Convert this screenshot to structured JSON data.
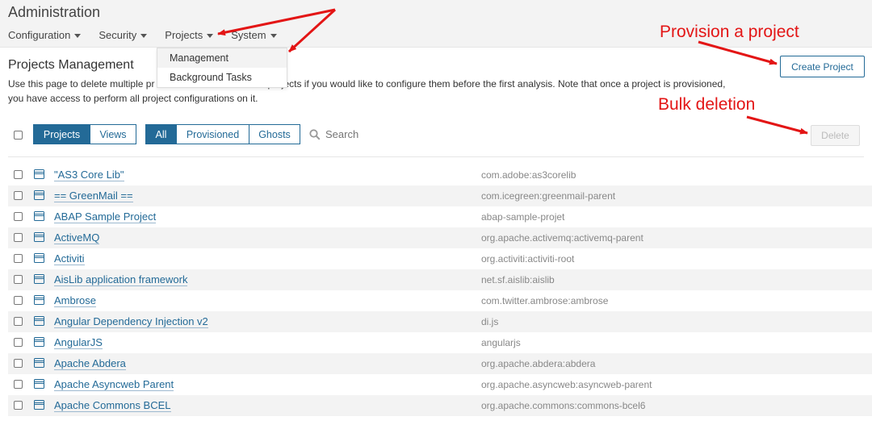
{
  "header": {
    "title": "Administration",
    "nav": [
      {
        "label": "Configuration"
      },
      {
        "label": "Security"
      },
      {
        "label": "Projects"
      },
      {
        "label": "System"
      }
    ],
    "dropdown": [
      {
        "label": "Management"
      },
      {
        "label": "Background Tasks"
      }
    ]
  },
  "page": {
    "title": "Projects Management",
    "desc_line1": "Use this page to delete multiple pr",
    "desc_line1_tail": "projects if you would like to configure them before the first analysis. Note that once a project is provisioned,",
    "desc_line2": "you have access to perform all project configurations on it.",
    "create_label": "Create Project",
    "delete_label": "Delete"
  },
  "filters": {
    "type": [
      "Projects",
      "Views"
    ],
    "state": [
      "All",
      "Provisioned",
      "Ghosts"
    ],
    "search_placeholder": "Search"
  },
  "projects": [
    {
      "name": "\"AS3 Core Lib\"",
      "key": "com.adobe:as3corelib"
    },
    {
      "name": "== GreenMail ==",
      "key": "com.icegreen:greenmail-parent"
    },
    {
      "name": "ABAP Sample Project",
      "key": "abap-sample-projet"
    },
    {
      "name": "ActiveMQ",
      "key": "org.apache.activemq:activemq-parent"
    },
    {
      "name": "Activiti",
      "key": "org.activiti:activiti-root"
    },
    {
      "name": "AisLib application framework",
      "key": "net.sf.aislib:aislib"
    },
    {
      "name": "Ambrose",
      "key": "com.twitter.ambrose:ambrose"
    },
    {
      "name": "Angular Dependency Injection v2",
      "key": "di.js"
    },
    {
      "name": "AngularJS",
      "key": "angularjs"
    },
    {
      "name": "Apache Abdera",
      "key": "org.apache.abdera:abdera"
    },
    {
      "name": "Apache Asyncweb Parent",
      "key": "org.apache.asyncweb:asyncweb-parent"
    },
    {
      "name": "Apache Commons BCEL",
      "key": "org.apache.commons:commons-bcel6"
    }
  ],
  "annotations": {
    "provision": "Provision a project",
    "bulk": "Bulk deletion"
  },
  "colors": {
    "accent": "#236a97",
    "annotation": "#e31515"
  }
}
